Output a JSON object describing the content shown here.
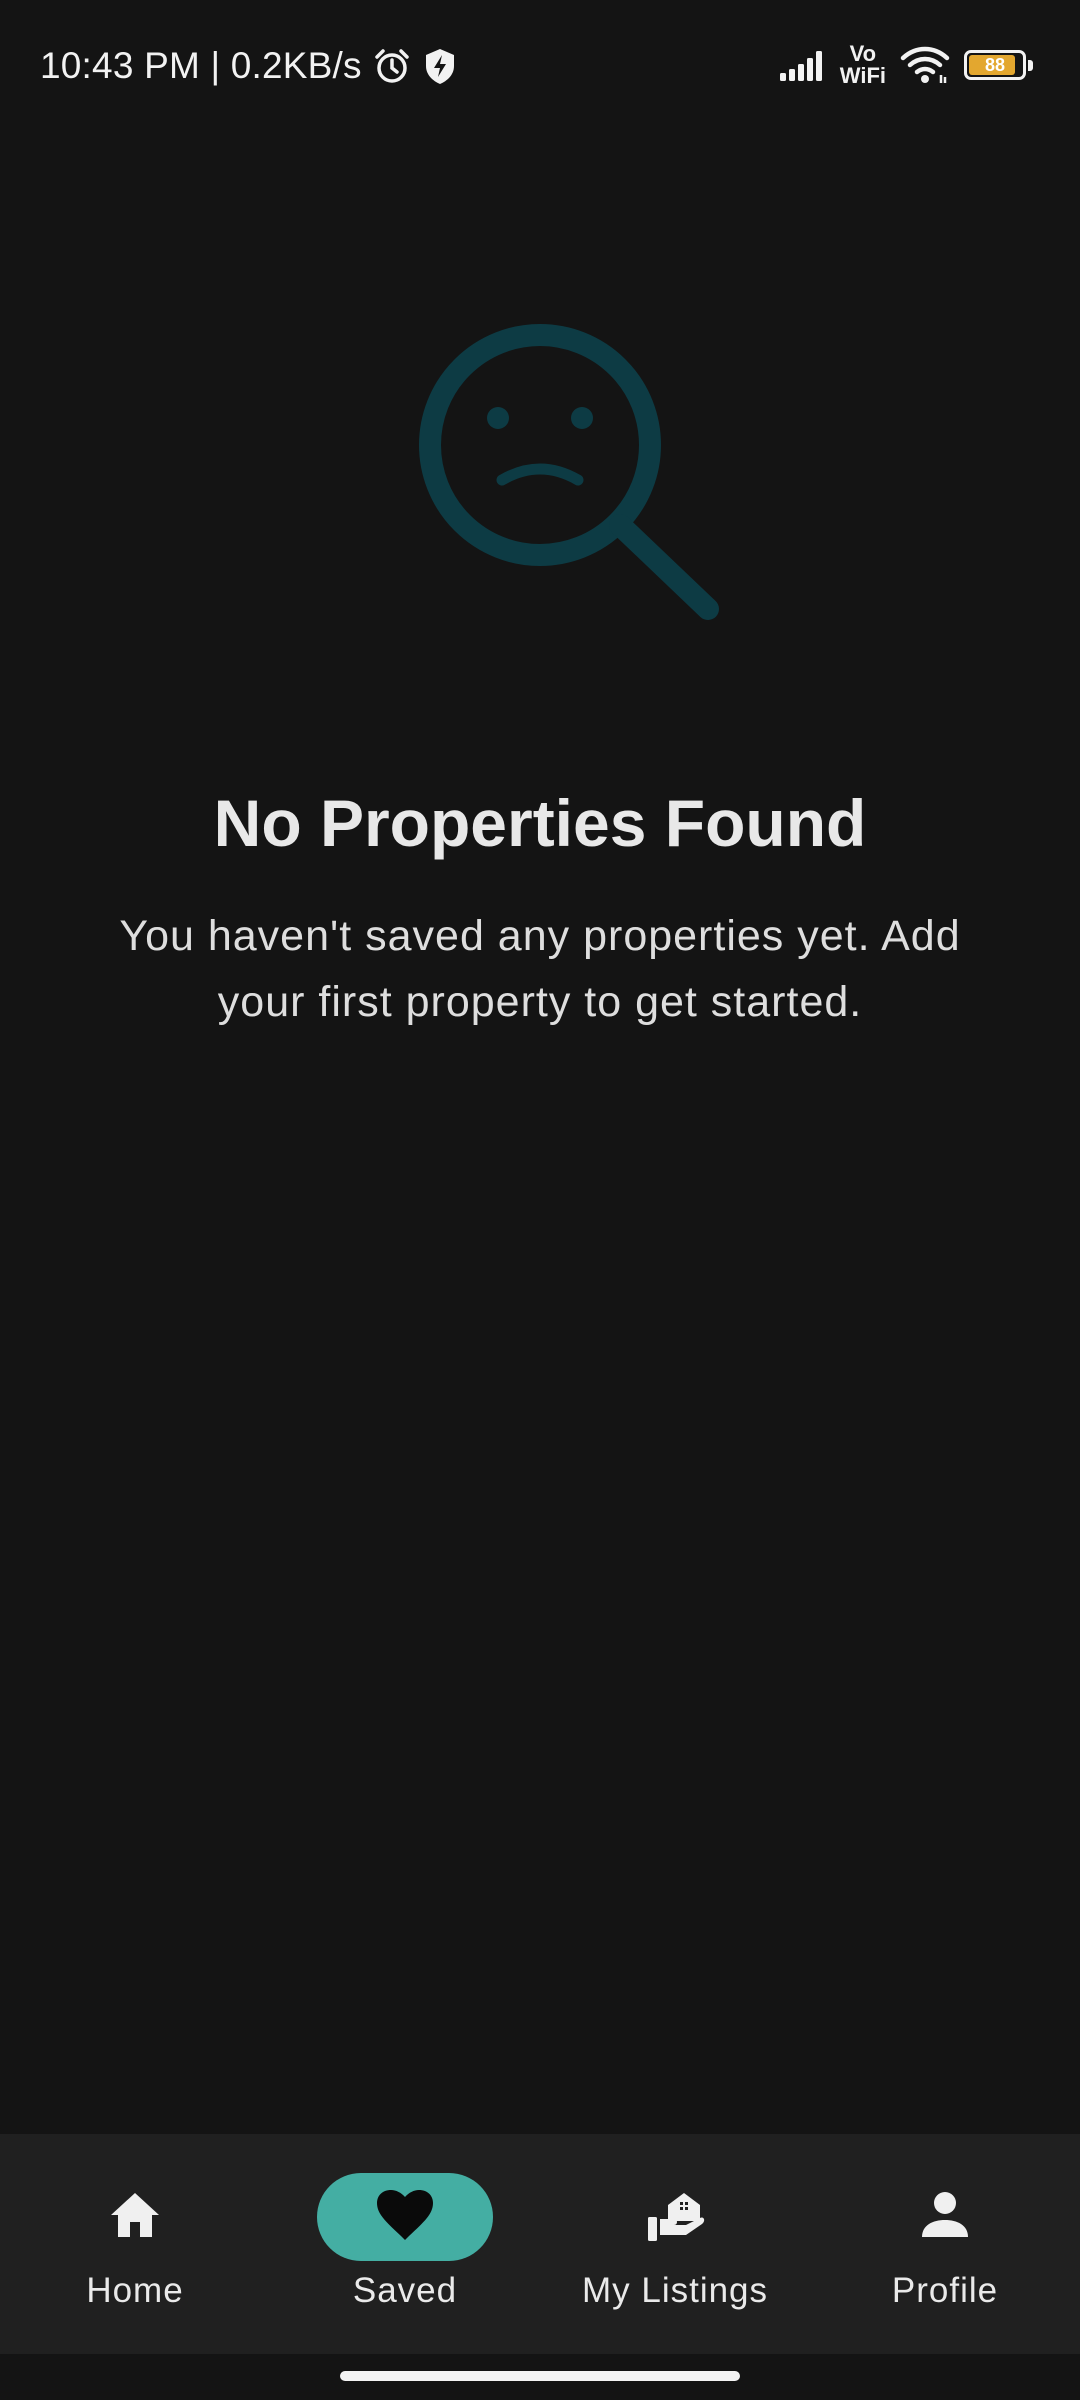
{
  "status_bar": {
    "time_speed": "10:43 PM | 0.2KB/s",
    "vowifi_top": "Vo",
    "vowifi_bottom": "WiFi",
    "battery_level": "88",
    "battery_fraction": 0.88,
    "battery_color": "#e3a72f"
  },
  "empty_state": {
    "icon": "sad-search-icon",
    "title": "No Properties Found",
    "message": "You haven't saved any properties yet. Add your first property to get started."
  },
  "bottom_nav": {
    "accent": "#44aea3",
    "items": [
      {
        "label": "Home",
        "icon": "home-icon",
        "active": false
      },
      {
        "label": "Saved",
        "icon": "heart-icon",
        "active": true
      },
      {
        "label": "My Listings",
        "icon": "listings-icon",
        "active": false
      },
      {
        "label": "Profile",
        "icon": "person-icon",
        "active": false
      }
    ]
  }
}
